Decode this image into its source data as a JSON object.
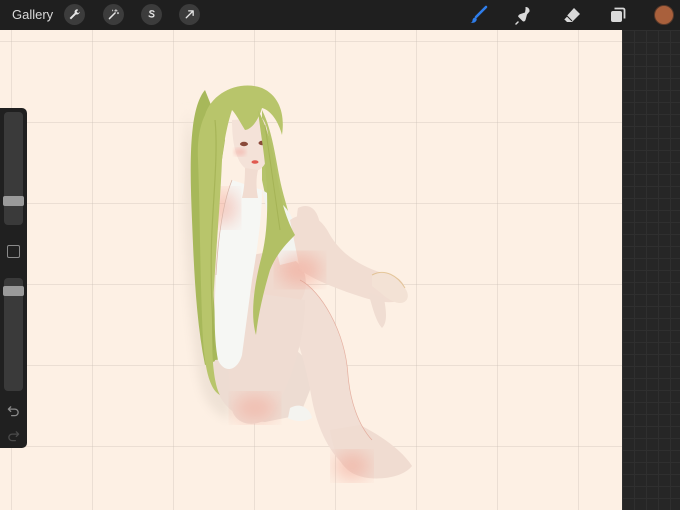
{
  "toolbar": {
    "gallery_label": "Gallery",
    "left_tools": [
      "wrench-icon",
      "magic-wand-icon",
      "selection-s-icon",
      "transform-arrow-icon"
    ],
    "right_tools": [
      "brush-icon",
      "smudge-icon",
      "eraser-icon",
      "layers-icon"
    ],
    "active_tool": "brush-icon",
    "active_color": "#a9603c",
    "accent_color": "#2f7dea"
  },
  "sidebar": {
    "brush_size": 0.18,
    "brush_opacity": 0.92,
    "icons": [
      "modify-square-icon",
      "undo-icon",
      "redo-icon"
    ]
  },
  "canvas": {
    "background_color": "#fdf0e4",
    "grid": true
  }
}
